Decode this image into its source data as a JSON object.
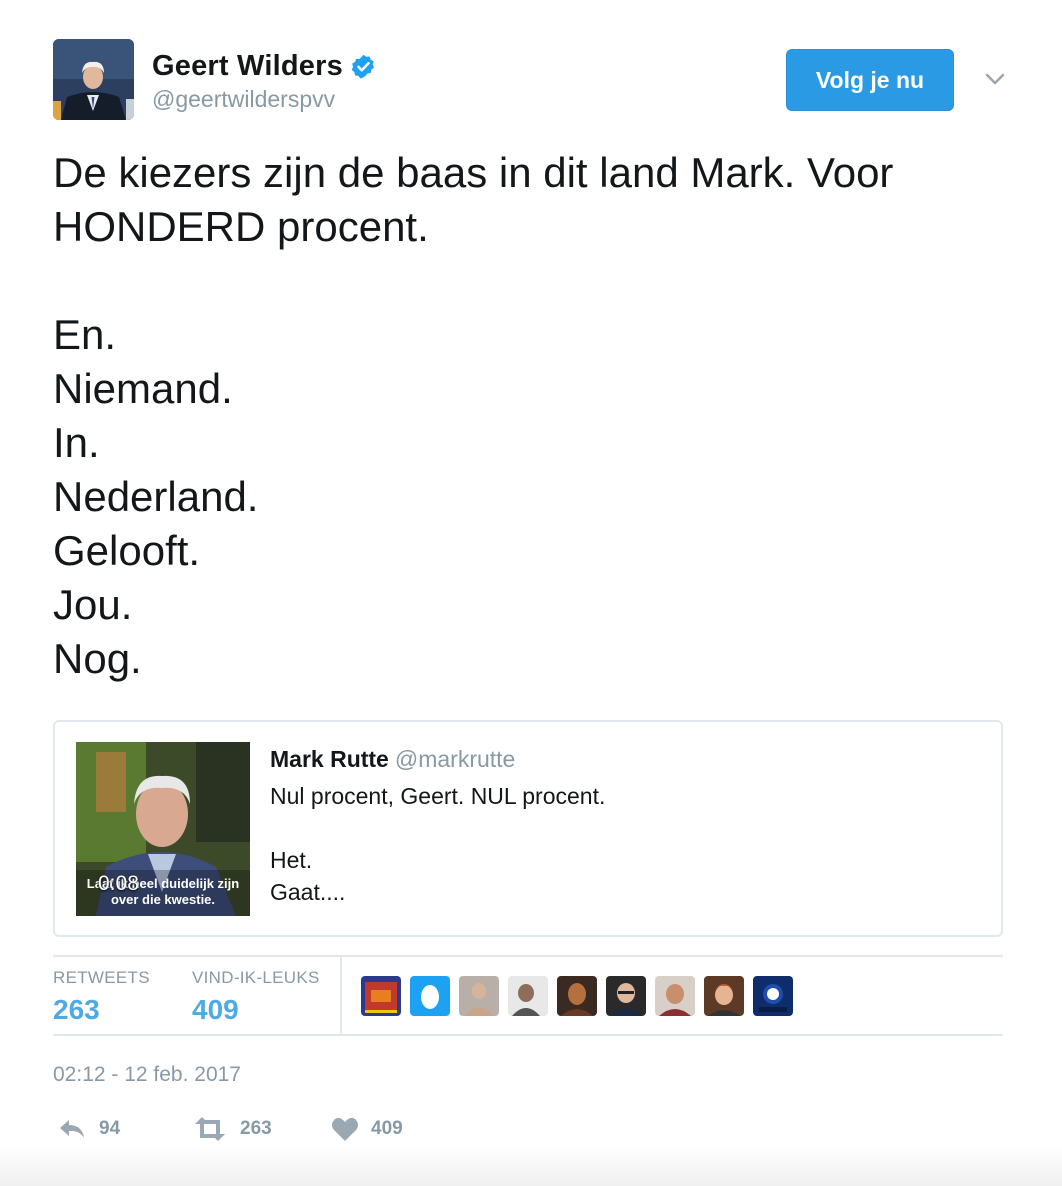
{
  "author": {
    "name": "Geert Wilders",
    "handle": "@geertwilderspvv",
    "verified": true
  },
  "follow_button": {
    "label": "Volg je nu",
    "color": "#2b9ae4"
  },
  "tweet": {
    "lines": [
      "De kiezers zijn de baas in dit land Mark. Voor",
      "HONDERD procent.",
      "",
      "En.",
      "Niemand.",
      "In.",
      "Nederland.",
      "Gelooft.",
      "Jou.",
      "Nog."
    ]
  },
  "quoted_tweet": {
    "name": "Mark Rutte",
    "handle": "@markrutte",
    "lines": [
      "Nul procent, Geert. NUL procent.",
      "",
      "Het.",
      "Gaat...."
    ],
    "video": {
      "duration": "0:08",
      "subtitle_line1": "Laat ik heel duidelijk zijn",
      "subtitle_line2": "over die kwestie."
    }
  },
  "stats": {
    "retweets_label": "RETWEETS",
    "retweets_value": "263",
    "likes_label": "VIND-IK-LEUKS",
    "likes_value": "409",
    "accent_color": "#4fa9e5"
  },
  "likers_count_shown": 9,
  "timestamp": "02:12 - 12 feb. 2017",
  "actions": {
    "reply_count": "94",
    "retweet_count": "263",
    "like_count": "409"
  }
}
